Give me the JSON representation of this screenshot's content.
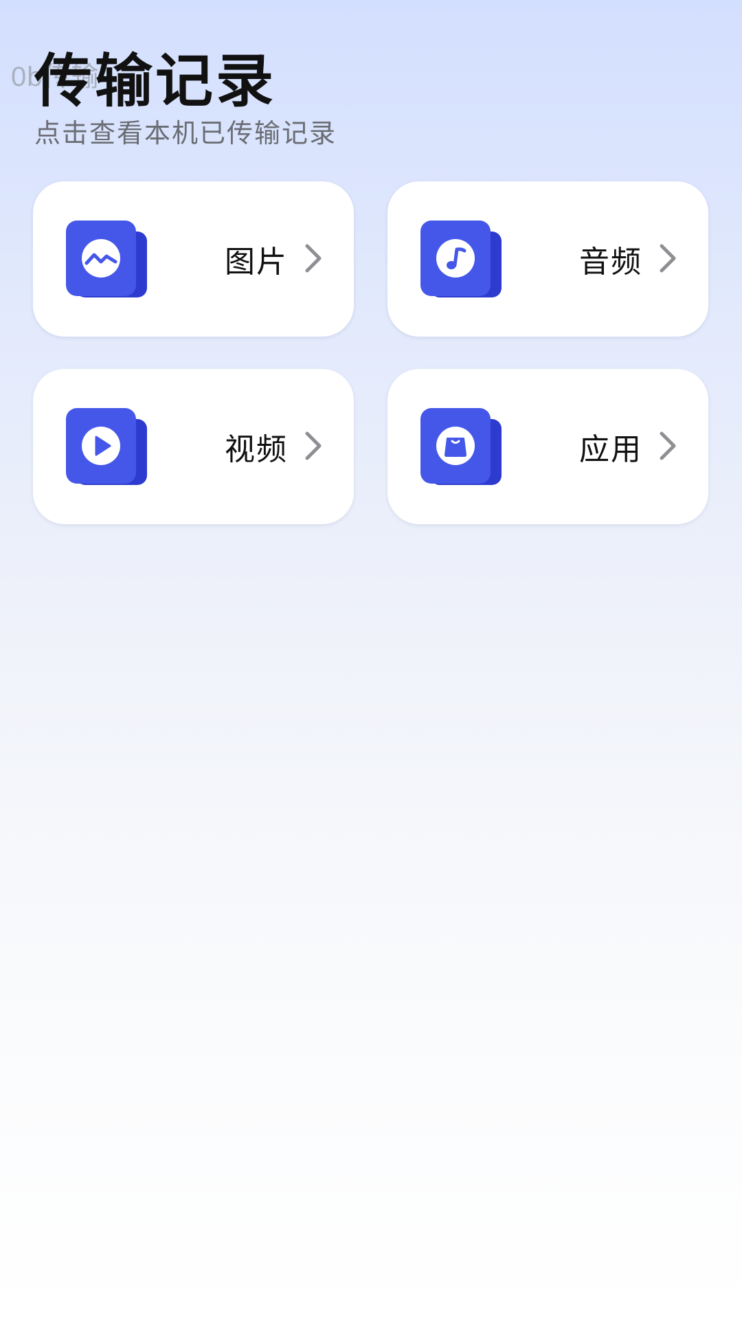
{
  "overlay_text": "0b传输",
  "header": {
    "title": "传输记录",
    "subtitle": "点击查看本机已传输记录"
  },
  "categories": [
    {
      "label": "图片",
      "icon": "image-icon"
    },
    {
      "label": "音频",
      "icon": "music-note-icon"
    },
    {
      "label": "视频",
      "icon": "play-icon"
    },
    {
      "label": "应用",
      "icon": "app-bag-icon"
    }
  ],
  "colors": {
    "accent": "#4457E8",
    "accent_dark": "#2D3CCF",
    "card_bg": "#FFFFFF",
    "title_text": "#111111",
    "subtitle_text": "#6A6D73",
    "chevron": "#8E8E93"
  }
}
